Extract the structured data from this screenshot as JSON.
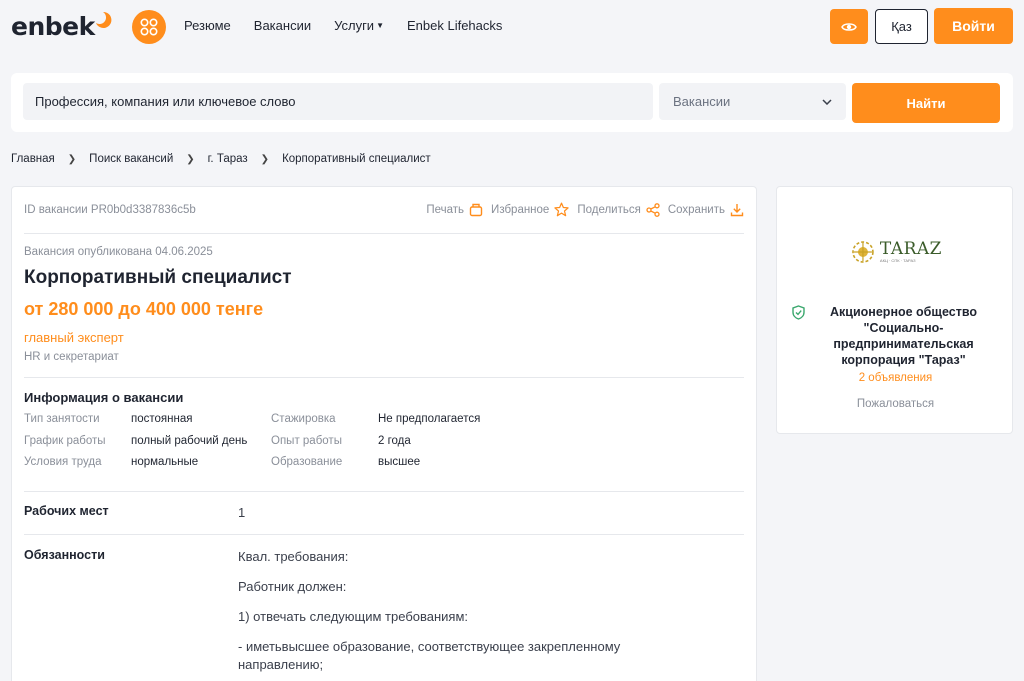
{
  "header": {
    "logo_text": "enbek",
    "nav": [
      {
        "label": "Резюме"
      },
      {
        "label": "Вакансии"
      },
      {
        "label": "Услуги"
      },
      {
        "label": "Enbek Lifehacks"
      }
    ],
    "lang_label": "Қаз",
    "login_label": "Войти"
  },
  "search": {
    "placeholder": "Профессия, компания или ключевое слово",
    "type_selected": "Вакансии",
    "button_label": "Найти"
  },
  "breadcrumb": [
    "Главная",
    "Поиск вакансий",
    "г. Тараз",
    "Корпоративный специалист"
  ],
  "vacancy": {
    "id_text": "ID вакансии PR0b0d3387836c5b",
    "actions": {
      "print": "Печать",
      "favorite": "Избранное",
      "share": "Поделиться",
      "save": "Сохранить"
    },
    "published": "Вакансия опубликована 04.06.2025",
    "title": "Корпоративный специалист",
    "salary": "от 280 000 до 400 000 тенге",
    "position": "главный эксперт",
    "category": "HR и секретариат",
    "info_title": "Информация о вакансии",
    "info": [
      {
        "label": "Тип занятости",
        "value": "постоянная",
        "label2": "Стажировка",
        "value2": "Не предполагается"
      },
      {
        "label": "График работы",
        "value": "полный рабочий день",
        "label2": "Опыт работы",
        "value2": "2 года"
      },
      {
        "label": "Условия труда",
        "value": "нормальные",
        "label2": "Образование",
        "value2": "высшее"
      }
    ],
    "workplaces_label": "Рабочих мест",
    "workplaces_value": "1",
    "duties_label": "Обязанности",
    "duties": [
      "Квал. требования:",
      "Работник должен:",
      "1) отвечать следующим требованиям:",
      "- иметьвысшее образование, соответствующее закрепленному направлению;"
    ]
  },
  "company": {
    "logo_text": "TARAZ",
    "logo_subtext": "АКЦ · СПК · ТАРАЗ",
    "name": "Акционерное общество \"Социально-предпринимательская корпорация \"Тараз\"",
    "ads_count": "2 объявления",
    "complain": "Пожаловаться"
  },
  "colors": {
    "accent": "#ff8d1c",
    "text": "#1f2430",
    "muted": "#8a8f99",
    "verified": "#3aa76d"
  }
}
